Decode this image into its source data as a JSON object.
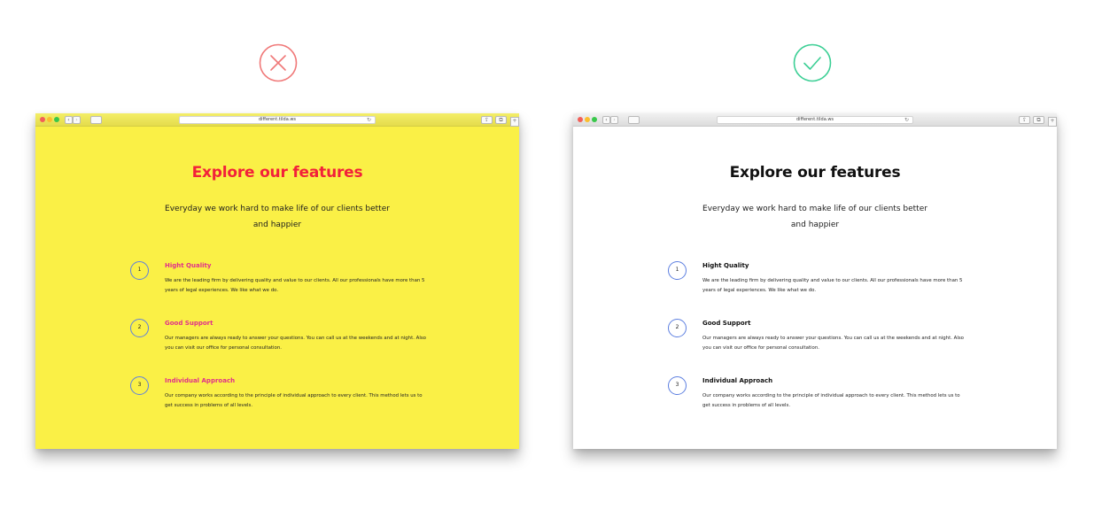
{
  "marks": {
    "bad": {
      "icon": "cross-icon",
      "color": "#f07878"
    },
    "good": {
      "icon": "check-icon",
      "color": "#3ccf95"
    }
  },
  "browser": {
    "url": "different.tilda.ws",
    "back_glyph": "‹",
    "forward_glyph": "›",
    "reload_glyph": "↻",
    "share_glyph": "⇪",
    "tabs_glyph": "⧉",
    "plus_glyph": "+"
  },
  "panels": {
    "bad": {
      "background": "#faf046",
      "heading_color": "#f2213a",
      "feature_title_color": "#e0308a"
    },
    "good": {
      "background": "#ffffff",
      "heading_color": "#111111",
      "feature_title_color": "#111111"
    }
  },
  "page": {
    "heading": "Explore our features",
    "subtitle": "Everyday we work hard to make life of our clients better and happier",
    "features": [
      {
        "number": "1",
        "title": "Hight Quality",
        "description": "We are the leading firm by delivering quality and value to our clients. All our professionals have more than 5 years of legal experiences. We like what we do."
      },
      {
        "number": "2",
        "title": "Good Support",
        "description": "Our managers are always ready to answer your questions. You can call us at the weekends and at night. Also you can visit our office for personal consultation."
      },
      {
        "number": "3",
        "title": "Individual Approach",
        "description": "Our company works according to the principle of individual approach to every client. This method lets us to get success in problems of all levels."
      }
    ]
  }
}
